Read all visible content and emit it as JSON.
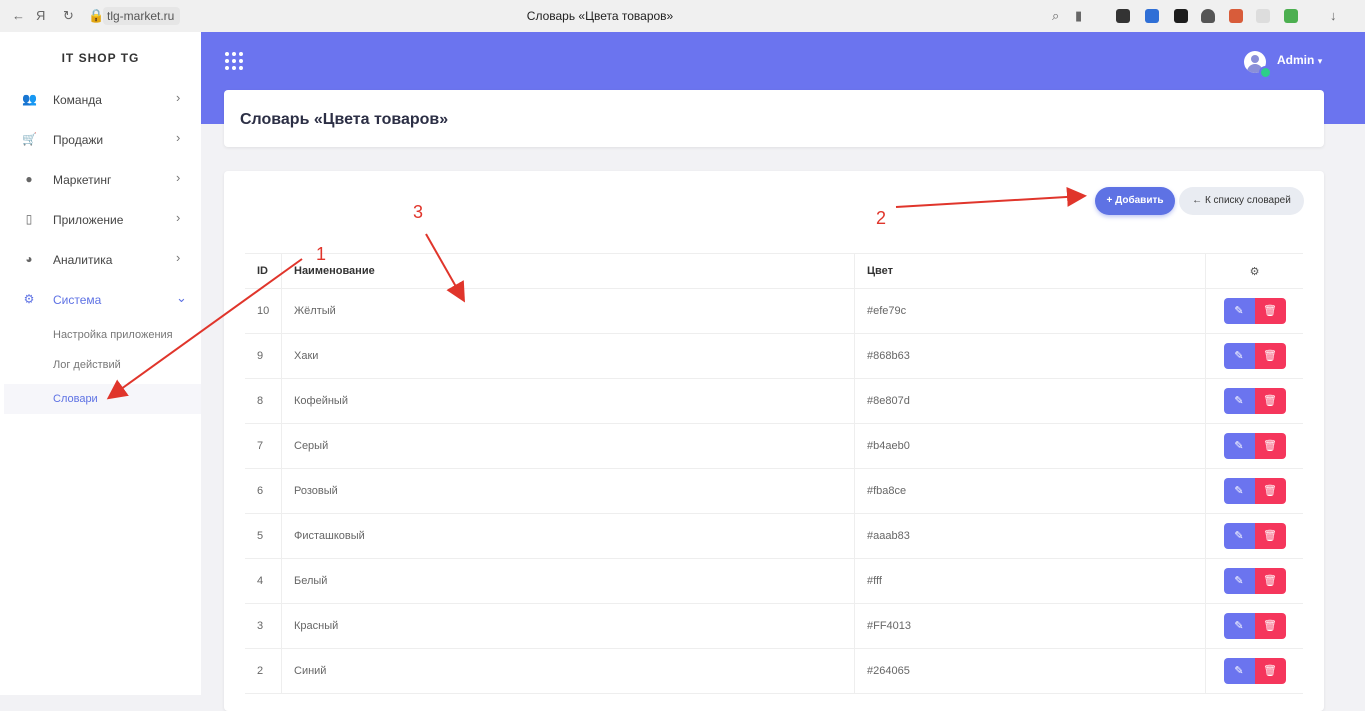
{
  "browser": {
    "url": "tlg-market.ru",
    "tab_title": "Словарь «Цвета товаров»"
  },
  "sidebar": {
    "brand": "IT SHOP TG",
    "items": [
      {
        "label": "Команда",
        "icon": "team-icon"
      },
      {
        "label": "Продажи",
        "icon": "cart-icon"
      },
      {
        "label": "Маркетинг",
        "icon": "marketing-icon"
      },
      {
        "label": "Приложение",
        "icon": "phone-icon"
      },
      {
        "label": "Аналитика",
        "icon": "pie-chart-icon"
      },
      {
        "label": "Система",
        "icon": "gears-icon"
      }
    ],
    "sub_items": [
      {
        "label": "Настройка приложения"
      },
      {
        "label": "Лог действий"
      },
      {
        "label": "Словари"
      }
    ]
  },
  "header": {
    "user_name": "Admin"
  },
  "page": {
    "title": "Словарь «Цвета товаров»",
    "add_button": "+ Добавить",
    "back_button": "← К списку словарей"
  },
  "table": {
    "columns": {
      "id": "ID",
      "name": "Наименование",
      "color": "Цвет",
      "actions_icon": "gear-icon"
    },
    "rows": [
      {
        "id": "10",
        "name": "Жёлтый",
        "color": "#efe79c"
      },
      {
        "id": "9",
        "name": "Хаки",
        "color": "#868b63"
      },
      {
        "id": "8",
        "name": "Кофейный",
        "color": "#8e807d"
      },
      {
        "id": "7",
        "name": "Серый",
        "color": "#b4aeb0"
      },
      {
        "id": "6",
        "name": "Розовый",
        "color": "#fba8ce"
      },
      {
        "id": "5",
        "name": "Фисташковый",
        "color": "#aaab83"
      },
      {
        "id": "4",
        "name": "Белый",
        "color": "#fff"
      },
      {
        "id": "3",
        "name": "Красный",
        "color": "#FF4013"
      },
      {
        "id": "2",
        "name": "Синий",
        "color": "#264065"
      }
    ]
  },
  "annotations": {
    "n1": "1",
    "n2": "2",
    "n3": "3"
  },
  "theme": {
    "accent": "#6b74ef",
    "danger": "#f5365c",
    "annotation": "#e0352b"
  }
}
